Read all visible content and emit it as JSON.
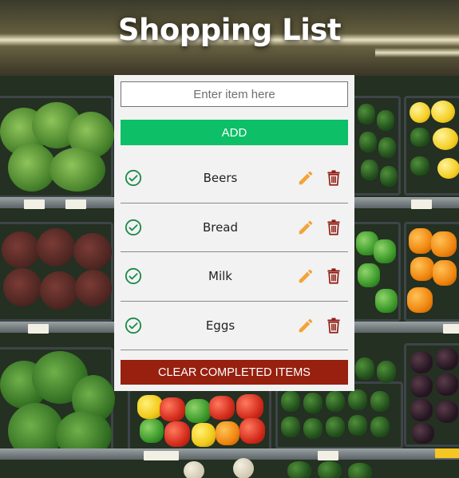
{
  "app": {
    "title": "Shopping List"
  },
  "form": {
    "input_placeholder": "Enter item here",
    "input_value": "",
    "add_label": "ADD"
  },
  "items": [
    {
      "name": "Beers",
      "icons": [
        "check-circle-icon",
        "pencil-icon",
        "trash-icon"
      ]
    },
    {
      "name": "Bread",
      "icons": [
        "check-circle-icon",
        "pencil-icon",
        "trash-icon"
      ]
    },
    {
      "name": "Milk",
      "icons": [
        "check-circle-icon",
        "pencil-icon",
        "trash-icon"
      ]
    },
    {
      "name": "Eggs",
      "icons": [
        "check-circle-icon",
        "pencil-icon",
        "trash-icon"
      ]
    }
  ],
  "footer": {
    "clear_label": "CLEAR COMPLETED ITEMS"
  },
  "colors": {
    "add_button": "#0dbf66",
    "clear_button": "#97200f",
    "check_icon": "#1b8a4a",
    "edit_icon": "#f2a43a",
    "delete_icon": "#8f1d12",
    "card_background": "#f2f2f2"
  }
}
